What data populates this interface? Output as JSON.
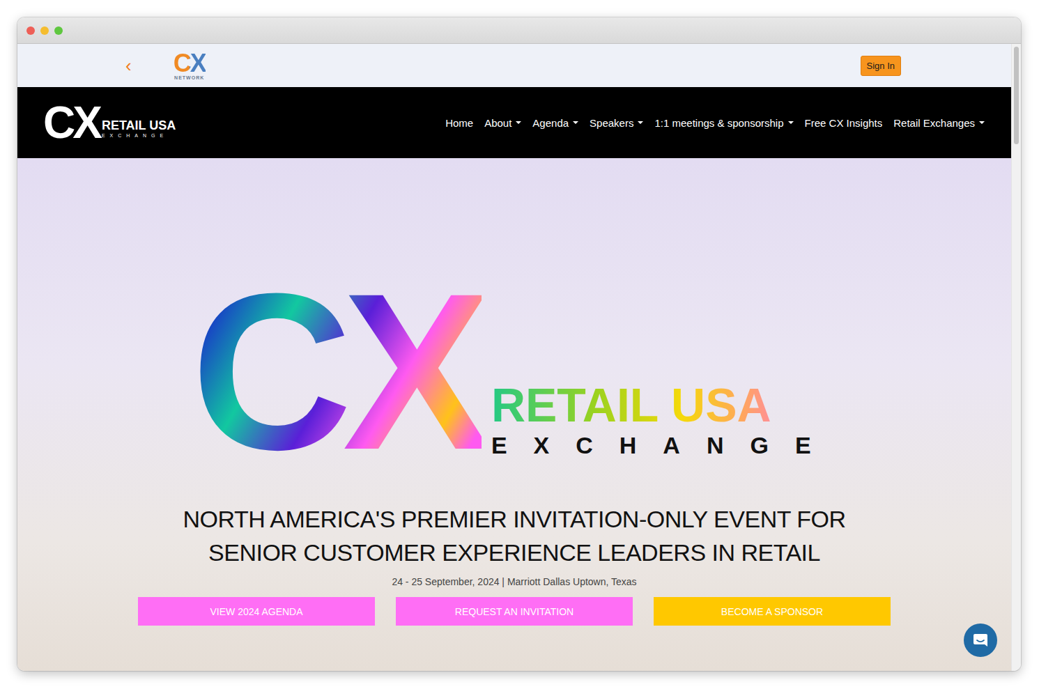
{
  "window_controls": [
    {
      "color": "#ee5f57"
    },
    {
      "color": "#f5bd2f"
    },
    {
      "color": "#5fc73f"
    }
  ],
  "topbar": {
    "back": "‹",
    "network_logo": {
      "mark": "CX",
      "caption": "NETWORK"
    },
    "sign_in": "Sign In"
  },
  "navbar": {
    "logo": {
      "mark": "CX",
      "title": "RETAIL USA",
      "subtitle": "EXCHANGE"
    },
    "items": [
      {
        "label": "Home",
        "dropdown": false
      },
      {
        "label": "About",
        "dropdown": true
      },
      {
        "label": "Agenda",
        "dropdown": true
      },
      {
        "label": "Speakers",
        "dropdown": true
      },
      {
        "label": "1:1 meetings & sponsorship",
        "dropdown": true
      },
      {
        "label": "Free CX Insights",
        "dropdown": false
      },
      {
        "label": "Retail Exchanges",
        "dropdown": true
      }
    ]
  },
  "hero": {
    "logo": {
      "mark": "CX",
      "title": "RETAIL USA",
      "subtitle": "EXCHANGE"
    },
    "headline": [
      "NORTH AMERICA'S PREMIER INVITATION-ONLY EVENT FOR",
      "SENIOR CUSTOMER EXPERIENCE LEADERS IN RETAIL"
    ],
    "details": "24 - 25 September, 2024 | Marriott Dallas Uptown, Texas",
    "buttons": [
      {
        "label": "VIEW 2024 AGENDA",
        "color": "#ff6ef5"
      },
      {
        "label": "REQUEST AN INVITATION",
        "color": "#ff6ef5"
      },
      {
        "label": "BECOME A SPONSOR",
        "color": "#ffc800"
      }
    ]
  }
}
